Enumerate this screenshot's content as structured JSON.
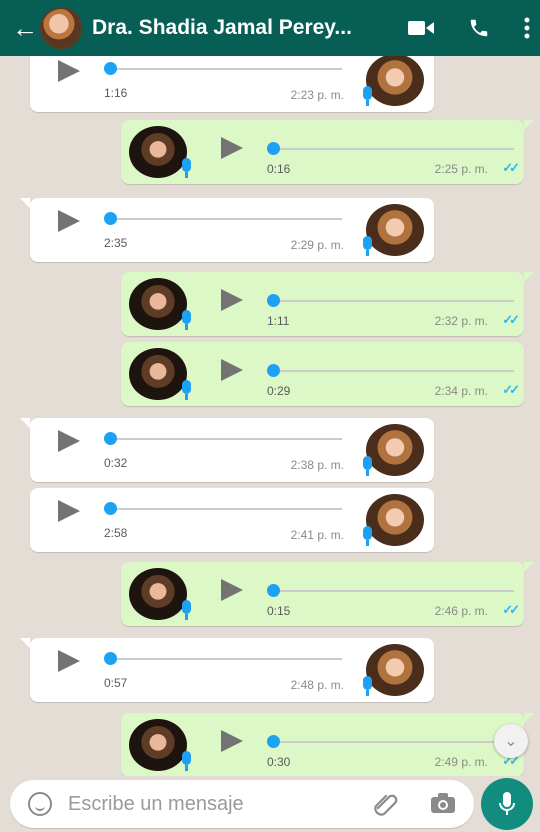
{
  "header": {
    "title": "Dra. Shadia Jamal Perey...",
    "back_icon": "arrow-left-icon",
    "video_icon": "video-call-icon",
    "call_icon": "phone-icon",
    "menu_icon": "more-vertical-icon"
  },
  "messages": [
    {
      "dir": "in",
      "duration": "1:16",
      "time": "2:23 p. m."
    },
    {
      "dir": "out",
      "duration": "0:16",
      "time": "2:25 p. m."
    },
    {
      "dir": "in",
      "duration": "2:35",
      "time": "2:29 p. m."
    },
    {
      "dir": "out",
      "duration": "1:11",
      "time": "2:32 p. m."
    },
    {
      "dir": "out",
      "duration": "0:29",
      "time": "2:34 p. m."
    },
    {
      "dir": "in",
      "duration": "0:32",
      "time": "2:38 p. m."
    },
    {
      "dir": "in",
      "duration": "2:58",
      "time": "2:41 p. m."
    },
    {
      "dir": "out",
      "duration": "0:15",
      "time": "2:46 p. m."
    },
    {
      "dir": "in",
      "duration": "0:57",
      "time": "2:48 p. m."
    },
    {
      "dir": "out",
      "duration": "0:30",
      "time": "2:49 p. m."
    }
  ],
  "input": {
    "placeholder": "Escribe un mensaje"
  },
  "colors": {
    "header": "#075e54",
    "incoming": "#ffffff",
    "outgoing": "#dcf8c6",
    "accent": "#1da1f2",
    "mic_button": "#128c7e"
  }
}
